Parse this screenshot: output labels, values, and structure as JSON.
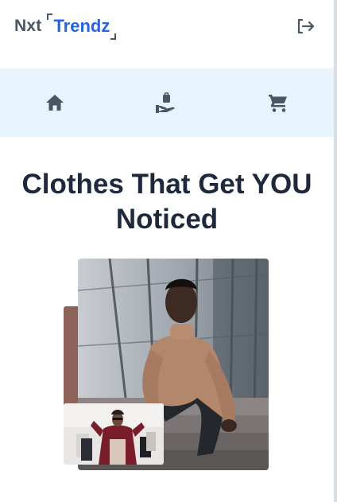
{
  "header": {
    "logo_prefix": "Nxt",
    "logo_name": "Trendz",
    "logout_icon": "logout-icon",
    "icon_color": "#4a5565",
    "brand_color": "#2563eb"
  },
  "nav": {
    "background": "#e8f4fd",
    "items": [
      {
        "icon": "home-icon"
      },
      {
        "icon": "products-icon"
      },
      {
        "icon": "cart-icon"
      }
    ]
  },
  "hero": {
    "title_line1": "Clothes That Get YOU",
    "title_line2": "Noticed",
    "accent_color": "#8d6259"
  }
}
